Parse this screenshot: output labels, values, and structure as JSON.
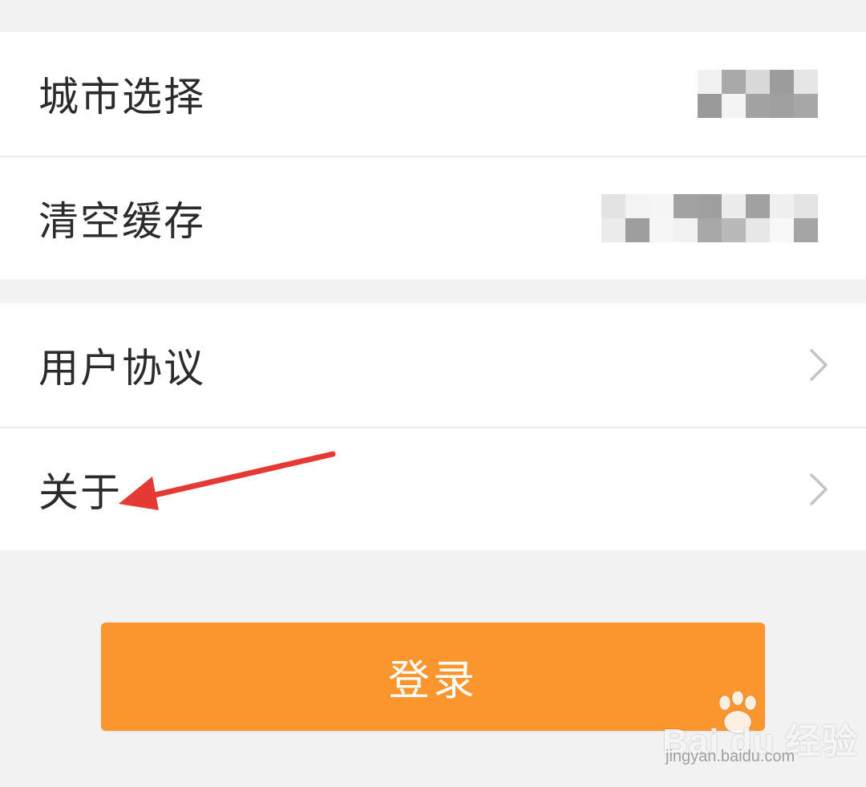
{
  "settings": {
    "group1": [
      {
        "label": "城市选择",
        "value_obscured": true
      },
      {
        "label": "清空缓存",
        "value_obscured": true
      }
    ],
    "group2": [
      {
        "label": "用户协议",
        "has_chevron": true
      },
      {
        "label": "关于",
        "has_chevron": true
      }
    ]
  },
  "login_button": {
    "label": "登录",
    "color": "#fb962f"
  },
  "annotation": {
    "type": "red-arrow",
    "color": "#e53935",
    "points_to": "关于"
  },
  "watermark": {
    "brand": "Bai du 经验",
    "url": "jingyan.baidu.com"
  },
  "colors": {
    "background": "#f2f2f2",
    "row": "#ffffff",
    "text": "#2b2b2b",
    "chevron": "#c4c4c4"
  },
  "icons": [
    "chevron-right-icon",
    "paw-icon"
  ]
}
